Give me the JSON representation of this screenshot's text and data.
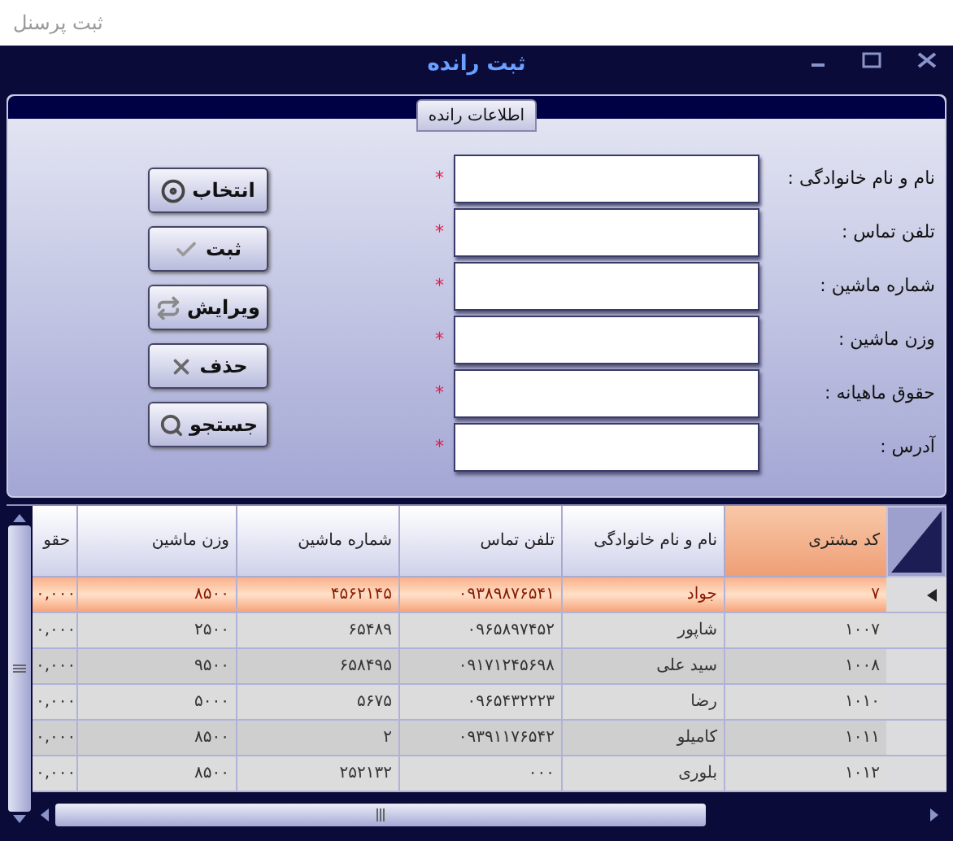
{
  "app_title": "ثبت پرسنل",
  "window": {
    "title": "ثبت رانده"
  },
  "group": {
    "title": "اطلاعات رانده"
  },
  "fields": [
    {
      "label": "نام و نام خانوادگی :",
      "mark": "*"
    },
    {
      "label": "تلفن تماس :",
      "mark": "*"
    },
    {
      "label": "شماره ماشین :",
      "mark": "*"
    },
    {
      "label": "وزن ماشین :",
      "mark": "*"
    },
    {
      "label": "حقوق ماهیانه :",
      "mark": "*"
    },
    {
      "label": "آدرس :",
      "mark": "*"
    }
  ],
  "buttons": [
    {
      "label": "انتخاب",
      "kind": "select"
    },
    {
      "label": "ثبت",
      "kind": "save"
    },
    {
      "label": "ویرایش",
      "kind": "edit"
    },
    {
      "label": "حذف",
      "kind": "delete"
    },
    {
      "label": "جستجو",
      "kind": "search"
    }
  ],
  "table": {
    "columns": [
      "کد مشتری",
      "نام و نام خانوادگی",
      "تلفن تماس",
      "شماره ماشین",
      "وزن ماشین",
      "حقو"
    ],
    "rows": [
      {
        "selected": true,
        "cells": [
          "۷",
          "جواد",
          "۰۹۳۸۹۸۷۶۵۴۱",
          "۴۵۶۲۱۴۵",
          "۸۵۰۰",
          "۰,۰۰۰"
        ]
      },
      {
        "selected": false,
        "cells": [
          "۱۰۰۷",
          "شاپور",
          "۰۹۶۵۸۹۷۴۵۲",
          "۶۵۴۸۹",
          "۲۵۰۰",
          "۰,۰۰۰"
        ]
      },
      {
        "selected": false,
        "cells": [
          "۱۰۰۸",
          "سید علی",
          "۰۹۱۷۱۲۴۵۶۹۸",
          "۶۵۸۴۹۵",
          "۹۵۰۰",
          "۰,۰۰۰"
        ]
      },
      {
        "selected": false,
        "cells": [
          "۱۰۱۰",
          "رضا",
          "۰۹۶۵۴۳۲۲۲۳",
          "۵۶۷۵",
          "۵۰۰۰",
          "۰,۰۰۰"
        ]
      },
      {
        "selected": false,
        "cells": [
          "۱۰۱۱",
          "کامیلو",
          "۰۹۳۹۱۱۷۶۵۴۲",
          "۲",
          "۸۵۰۰",
          "۰,۰۰۰"
        ]
      },
      {
        "selected": false,
        "cells": [
          "۱۰۱۲",
          "بلوری",
          "۰۰۰",
          "۲۵۲۱۳۲",
          "۸۵۰۰",
          "۰,۰۰۰"
        ]
      }
    ]
  }
}
